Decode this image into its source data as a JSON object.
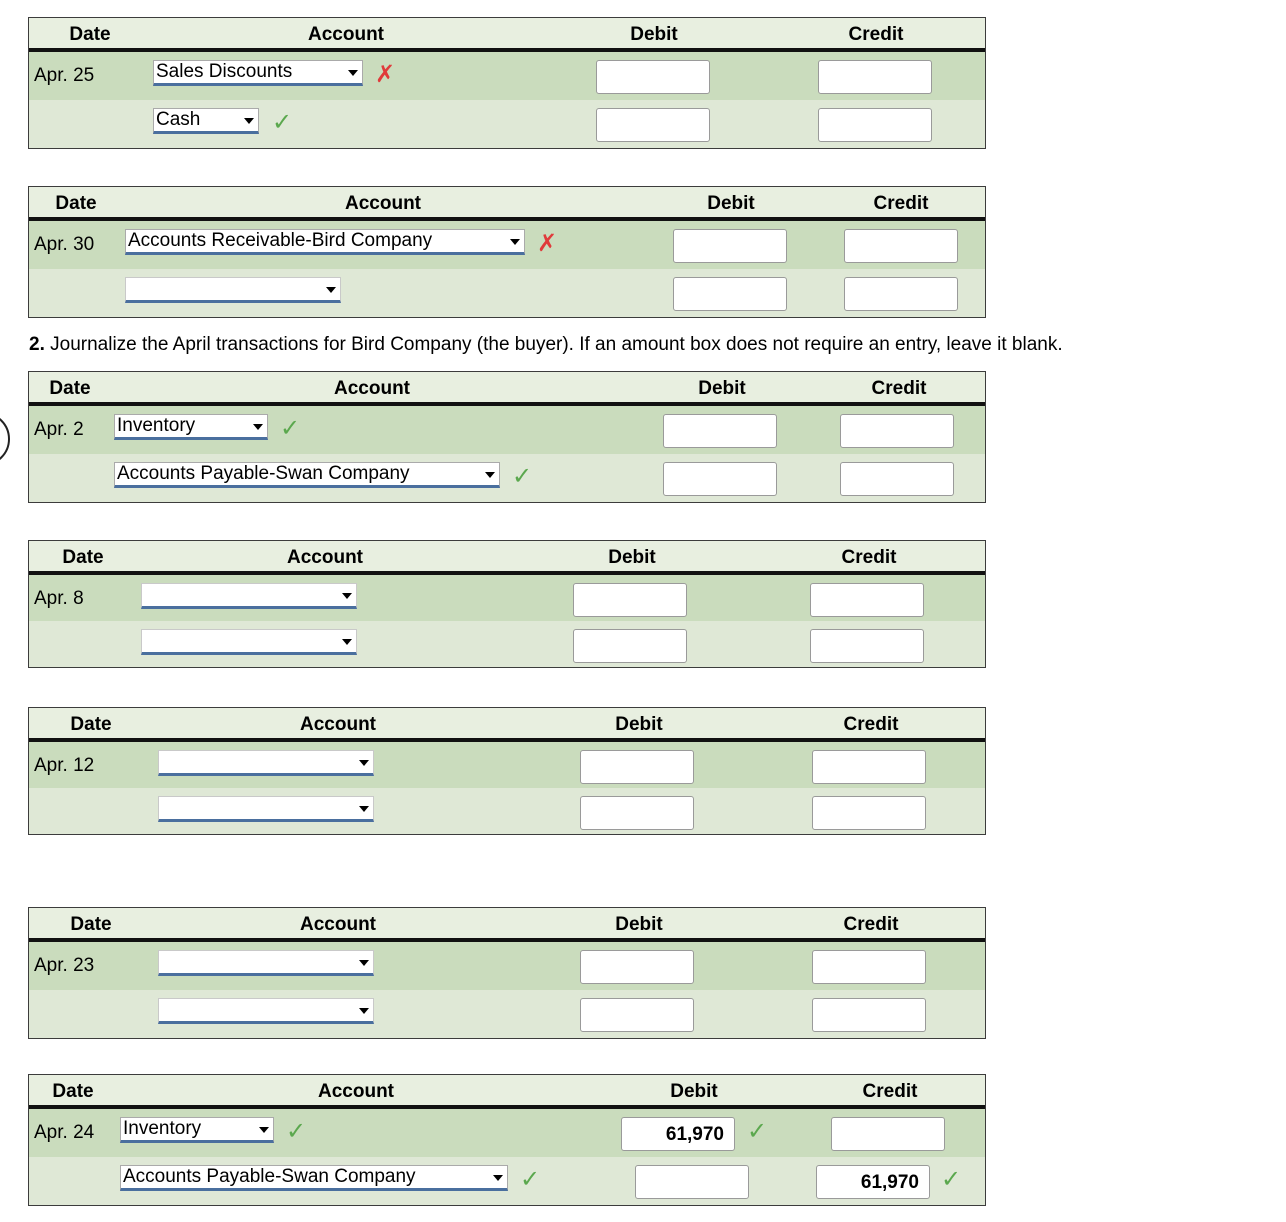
{
  "tables": [
    {
      "headers": {
        "date": "Date",
        "account": "Account",
        "debit": "Debit",
        "credit": "Credit"
      },
      "rows": [
        {
          "date": "Apr. 25",
          "account": "Sales Discounts",
          "mark": "x-icon",
          "debit": "",
          "credit": ""
        },
        {
          "date": "",
          "account": "Cash",
          "mark": "check-icon",
          "debit": "",
          "credit": ""
        }
      ]
    },
    {
      "headers": {
        "date": "Date",
        "account": "Account",
        "debit": "Debit",
        "credit": "Credit"
      },
      "rows": [
        {
          "date": "Apr. 30",
          "account": "Accounts Receivable-Bird Company",
          "mark": "x-icon",
          "debit": "",
          "credit": ""
        },
        {
          "date": "",
          "account": "",
          "mark": "",
          "debit": "",
          "credit": ""
        }
      ]
    },
    {
      "headers": {
        "date": "Date",
        "account": "Account",
        "debit": "Debit",
        "credit": "Credit"
      },
      "rows": [
        {
          "date": "Apr. 2",
          "account": "Inventory",
          "mark": "check-icon",
          "debit": "",
          "credit": ""
        },
        {
          "date": "",
          "account": "Accounts Payable-Swan Company",
          "mark": "check-icon",
          "debit": "",
          "credit": ""
        }
      ]
    },
    {
      "headers": {
        "date": "Date",
        "account": "Account",
        "debit": "Debit",
        "credit": "Credit"
      },
      "rows": [
        {
          "date": "Apr. 8",
          "account": "",
          "mark": "",
          "debit": "",
          "credit": ""
        },
        {
          "date": "",
          "account": "",
          "mark": "",
          "debit": "",
          "credit": ""
        }
      ]
    },
    {
      "headers": {
        "date": "Date",
        "account": "Account",
        "debit": "Debit",
        "credit": "Credit"
      },
      "rows": [
        {
          "date": "Apr. 12",
          "account": "",
          "mark": "",
          "debit": "",
          "credit": ""
        },
        {
          "date": "",
          "account": "",
          "mark": "",
          "debit": "",
          "credit": ""
        }
      ]
    },
    {
      "headers": {
        "date": "Date",
        "account": "Account",
        "debit": "Debit",
        "credit": "Credit"
      },
      "rows": [
        {
          "date": "Apr. 23",
          "account": "",
          "mark": "",
          "debit": "",
          "credit": ""
        },
        {
          "date": "",
          "account": "",
          "mark": "",
          "debit": "",
          "credit": ""
        }
      ]
    },
    {
      "headers": {
        "date": "Date",
        "account": "Account",
        "debit": "Debit",
        "credit": "Credit"
      },
      "rows": [
        {
          "date": "Apr. 24",
          "account": "Inventory",
          "mark": "check-icon",
          "debit": "61,970",
          "debit_mark": "check-icon",
          "credit": ""
        },
        {
          "date": "",
          "account": "Accounts Payable-Swan Company",
          "mark": "check-icon",
          "debit": "",
          "credit": "61,970",
          "credit_mark": "check-icon"
        }
      ]
    }
  ],
  "instruction": {
    "number": "2.",
    "text": "Journalize the April transactions for Bird Company (the buyer). If an amount box does not require an entry, leave it blank."
  },
  "colors": {
    "header_bg": "#e8efe0",
    "row_dark": "#cadcbd",
    "row_light": "#dfe8d6",
    "select_underline": "#4a6f9e",
    "incorrect": "#e03b3b",
    "correct": "#5ba84e"
  }
}
